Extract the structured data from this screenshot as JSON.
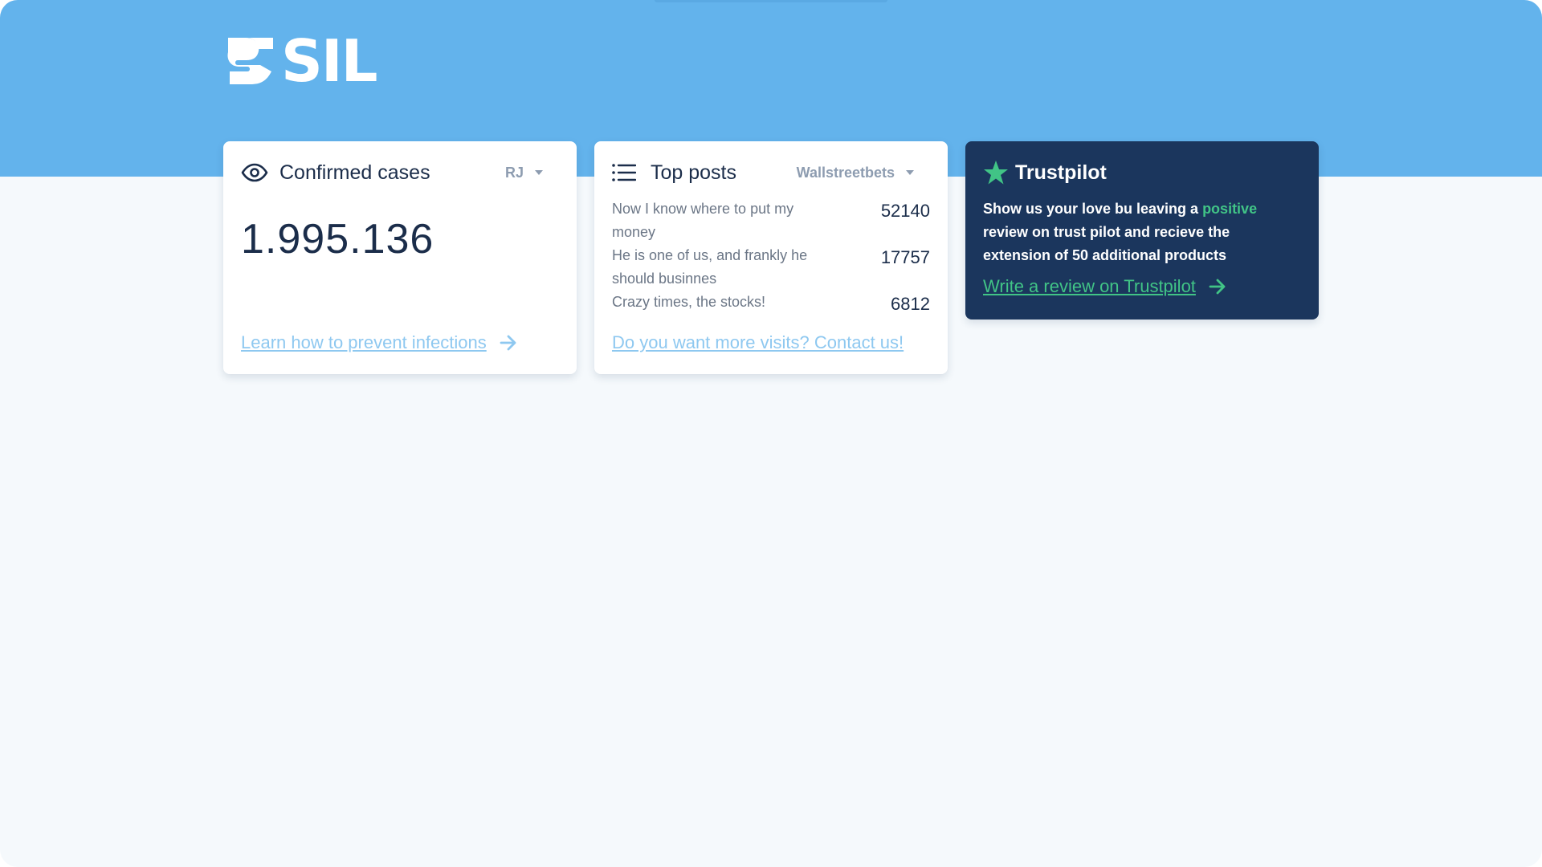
{
  "brand": {
    "logo_text": "SIL",
    "header_color": "#63b3ec"
  },
  "cases_card": {
    "icon": "eye-icon",
    "title": "Confirmed cases",
    "region": "RJ",
    "value": "1.995.136",
    "link_label": "Learn how to prevent infections"
  },
  "posts_card": {
    "icon": "list-icon",
    "title": "Top posts",
    "source": "Wallstreetbets",
    "posts": [
      {
        "title": "Now I know where to put my money",
        "count": "52140"
      },
      {
        "title": "He is one of us, and frankly he should businnes",
        "count": "17757"
      },
      {
        "title": "Crazy times, the stocks!",
        "count": "6812"
      }
    ],
    "link_label": "Do you want more visits? Contact us!"
  },
  "trust_card": {
    "icon": "star-icon",
    "title": "Trustpilot",
    "text_before": "Show us your love bu leaving a ",
    "text_highlight": "positive",
    "text_after": " review on trust pilot and recieve the extension of 50 additional products",
    "link_label": "Write a review on Trustpilot",
    "accent": "#41c486",
    "background": "#1b365d"
  }
}
